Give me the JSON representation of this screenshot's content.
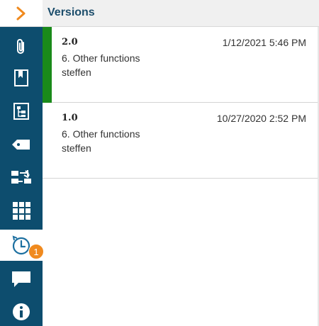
{
  "rail": {
    "items": [
      {
        "icon": "chevron-right-icon"
      },
      {
        "icon": "paperclip-icon"
      },
      {
        "icon": "bookmark-icon"
      },
      {
        "icon": "structure-icon"
      },
      {
        "icon": "tag-icon"
      },
      {
        "icon": "transfer-icon"
      },
      {
        "icon": "grid-icon"
      },
      {
        "icon": "history-icon"
      },
      {
        "icon": "comment-icon"
      },
      {
        "icon": "info-icon"
      }
    ],
    "history_badge": "1",
    "colors": {
      "rail_bg": "#0d4d6e",
      "accent": "#f08a1e",
      "selected_bar": "#1a8a1a"
    }
  },
  "panel": {
    "title": "Versions"
  },
  "versions": [
    {
      "number": "2.0",
      "date": "1/12/2021 5:46 PM",
      "description": "6. Other functions",
      "author": "steffen",
      "selected": true
    },
    {
      "number": "1.0",
      "date": "10/27/2020 2:52 PM",
      "description": "6. Other functions",
      "author": "steffen",
      "selected": false
    }
  ]
}
